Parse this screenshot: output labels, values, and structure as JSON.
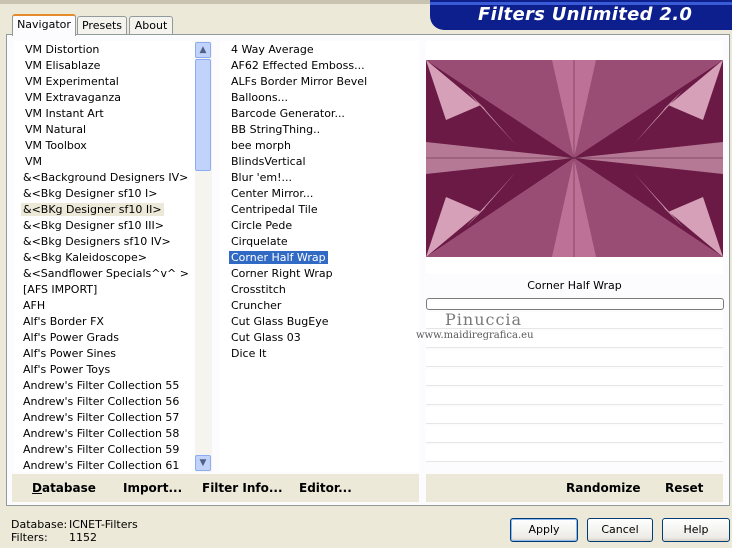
{
  "app": {
    "title": "Filters Unlimited 2.0"
  },
  "tabs": [
    {
      "label": "Navigator",
      "active": true
    },
    {
      "label": "Presets"
    },
    {
      "label": "About"
    }
  ],
  "categories": {
    "selected_index": 10,
    "items": [
      "VM Distortion",
      "VM Elisablaze",
      "VM Experimental",
      "VM Extravaganza",
      "VM Instant Art",
      "VM Natural",
      "VM Toolbox",
      "VM",
      "&<Background Designers IV>",
      "&<Bkg Designer sf10 I>",
      "&<BKg Designer sf10 II>",
      "&<Bkg Designer sf10 III>",
      "&<Bkg Designers sf10 IV>",
      "&<Bkg Kaleidoscope>",
      "&<Sandflower Specials^v^ >",
      "[AFS IMPORT]",
      "AFH",
      "Alf's Border FX",
      "Alf's Power Grads",
      "Alf's Power Sines",
      "Alf's Power Toys",
      "Andrew's Filter Collection 55",
      "Andrew's Filter Collection 56",
      "Andrew's Filter Collection 57",
      "Andrew's Filter Collection 58",
      "Andrew's Filter Collection 59",
      "Andrew's Filter Collection 61"
    ]
  },
  "filters": {
    "selected_index": 13,
    "items": [
      "4 Way Average",
      "AF62 Effected Emboss...",
      "ALFs Border Mirror Bevel",
      "Balloons...",
      "Barcode Generator...",
      "BB StringThing..",
      "bee morph",
      "BlindsVertical",
      "Blur 'em!...",
      "Center Mirror...",
      "Centripedal Tile",
      "Circle Pede",
      "Cirquelate",
      "Corner Half Wrap",
      "Corner Right Wrap",
      "Crosstitch",
      "Cruncher",
      "Cut Glass  BugEye",
      "Cut Glass 03",
      "Dice It"
    ]
  },
  "preview": {
    "filter_name": "Corner Half Wrap",
    "progress": 0,
    "colors": {
      "pink": "#c77a9f",
      "dark": "#6a1a44",
      "mid": "#9a4d74",
      "light": "#e7b9cc"
    }
  },
  "watermark": {
    "name": "Pinuccia",
    "site": "www.maidiregrafica.eu"
  },
  "bottom_links": {
    "database": "Database",
    "import": "Import...",
    "filter_info": "Filter Info...",
    "editor": "Editor...",
    "randomize": "Randomize",
    "reset": "Reset"
  },
  "status": {
    "database_label": "Database:",
    "database_value": "ICNET-Filters",
    "filters_label": "Filters:",
    "filters_value": "1152"
  },
  "buttons": {
    "apply": "Apply",
    "cancel": "Cancel",
    "help": "Help"
  }
}
